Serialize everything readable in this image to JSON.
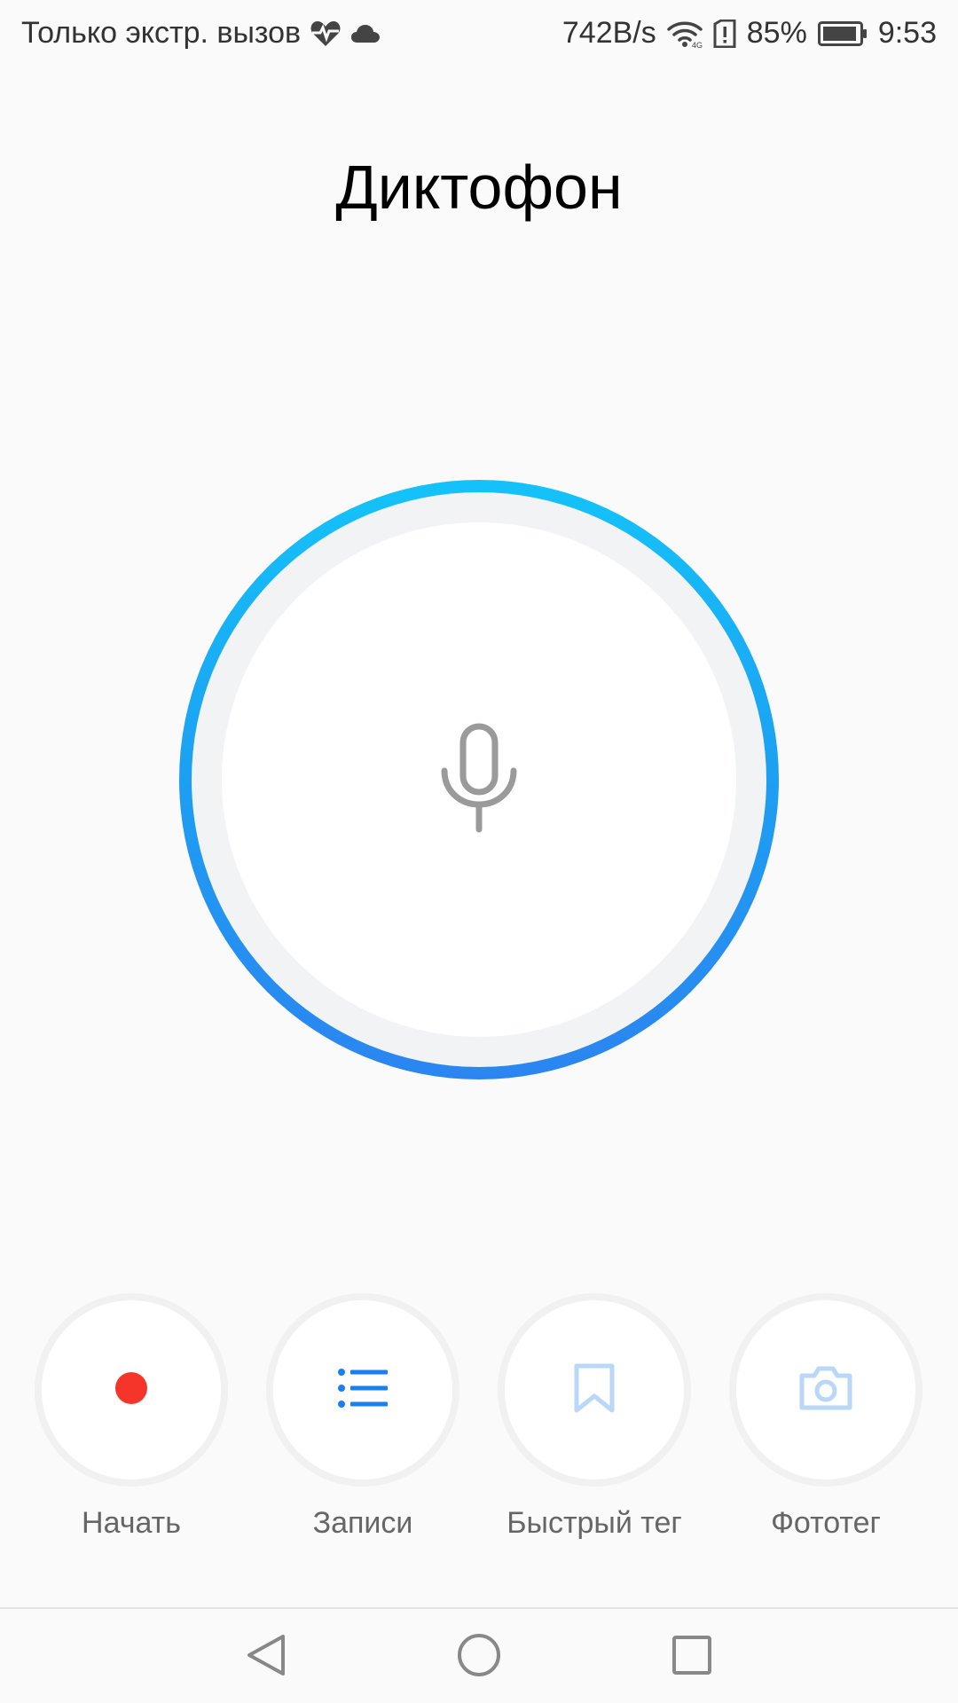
{
  "status_bar": {
    "carrier_text": "Только экстр. вызов",
    "net_speed": "742B/s",
    "battery_percent": "85%",
    "time": "9:53",
    "icons": [
      "heart-pulse-icon",
      "cloud-icon",
      "wifi-icon",
      "sim-alert-icon",
      "battery-icon"
    ]
  },
  "app": {
    "title": "Диктофон"
  },
  "recorder": {
    "center_icon": "microphone-icon",
    "ring_colors": [
      "#14c3f9",
      "#2b85f0"
    ]
  },
  "actions": [
    {
      "label": "Начать",
      "icon": "record-dot-icon",
      "color": "#f5352a"
    },
    {
      "label": "Записи",
      "icon": "list-icon",
      "color": "#1a7ff0"
    },
    {
      "label": "Быстрый тег",
      "icon": "bookmark-icon",
      "color": "#b9d7f7"
    },
    {
      "label": "Фототег",
      "icon": "camera-icon",
      "color": "#b9d7f7"
    }
  ],
  "nav_bar": {
    "icons": [
      "back-icon",
      "home-icon",
      "recents-icon"
    ]
  }
}
